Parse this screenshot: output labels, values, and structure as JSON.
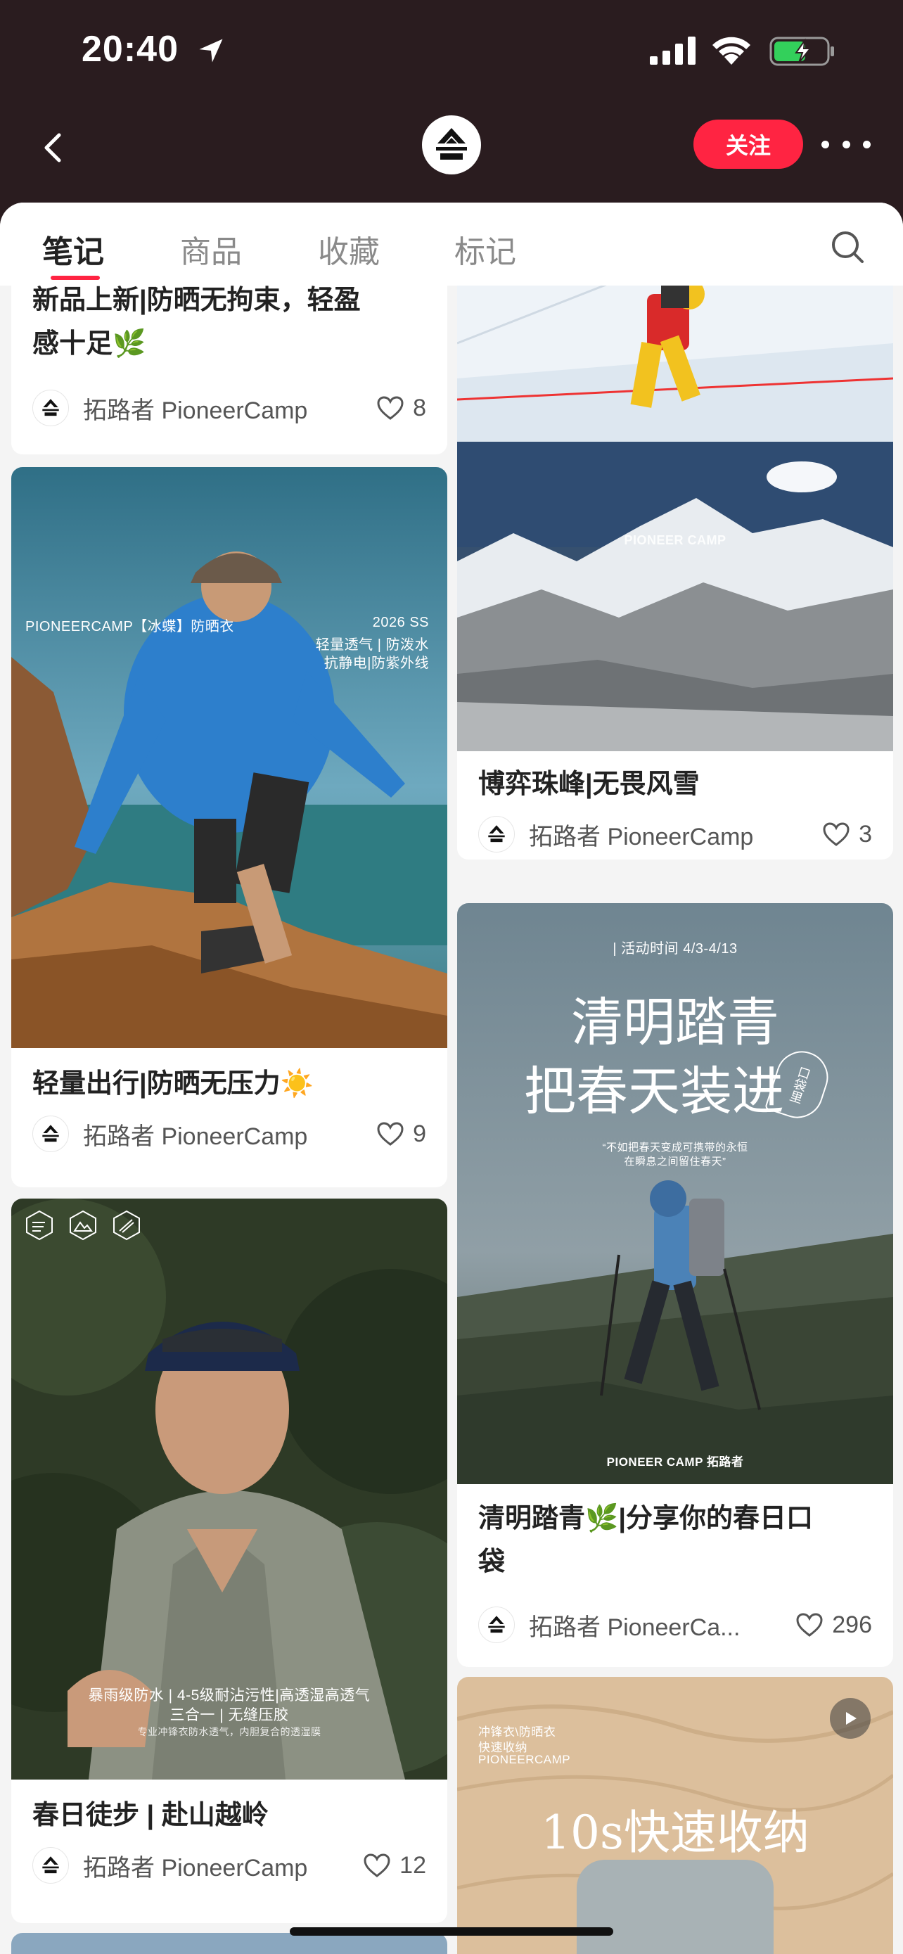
{
  "status": {
    "time": "20:40"
  },
  "header": {
    "follow_label": "关注"
  },
  "tabs": [
    {
      "label": "笔记",
      "active": true
    },
    {
      "label": "商品",
      "active": false
    },
    {
      "label": "收藏",
      "active": false
    },
    {
      "label": "标记",
      "active": false
    }
  ],
  "author": "拓路者 PioneerCamp",
  "author_truncated": "拓路者 PioneerCa...",
  "notes": {
    "n1": {
      "title_line1": "新品上新|防晒无拘束，轻盈",
      "title_line2": "感十足🌿",
      "likes": "8"
    },
    "n2": {
      "title": "轻量出行|防晒无压力☀️",
      "likes": "9",
      "img_left": "PIONEERCAMP【冰蝶】防晒衣",
      "img_right_1": "2026 SS",
      "img_right_2": "轻量透气 | 防泼水",
      "img_right_3": "抗静电|防紫外线"
    },
    "n3": {
      "title": "春日徒步 | 赴山越岭",
      "likes": "12",
      "img_line1": "暴雨级防水 | 4-5级耐沾污性|高透湿高透气",
      "img_line2": "三合一 | 无缝压胶",
      "img_line3": "专业冲锋衣防水透气，内胆复合的透湿膜"
    },
    "n4": {
      "title": "博弈珠峰|无畏风雪",
      "likes": "3",
      "img_logo": "PIONEER CAMP"
    },
    "n5": {
      "title_line1": "清明踏青🌿|分享你的春日口",
      "title_line2": "袋",
      "likes": "296",
      "img_top": "| 活动时间 4/3-4/13",
      "big_line1": "清明踏青",
      "big_line2": "把春天装进",
      "pocket_label": "口袋里",
      "quote1": "“不如把春天变成可携带的永恒",
      "quote2": "在瞬息之间留住春天”",
      "img_brand": "PIONEER CAMP 拓路者"
    },
    "n6": {
      "img_line1": "冲锋衣\\防晒衣",
      "img_line2": "快速收纳",
      "img_line3": "PIONEERCAMP",
      "big_title": "10s快速收纳"
    }
  },
  "colors": {
    "accent": "#ff2442",
    "header_bg": "#2a1c1f"
  }
}
